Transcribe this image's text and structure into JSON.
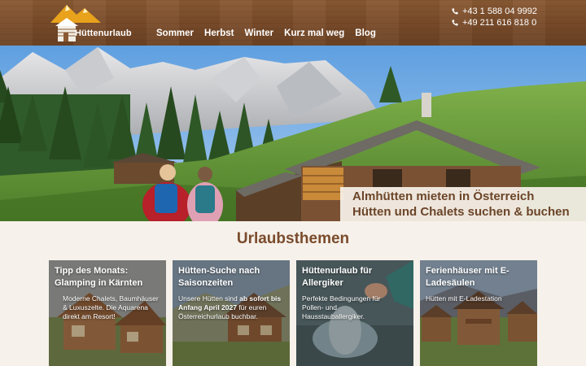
{
  "header": {
    "logo_text": "Hüttenurlaub",
    "nav": [
      {
        "label": "Sommer"
      },
      {
        "label": "Herbst"
      },
      {
        "label": "Winter"
      },
      {
        "label": "Kurz mal weg"
      },
      {
        "label": "Blog"
      }
    ],
    "phones": [
      {
        "number": "+43 1 588 04 9992",
        "icon": "phone-icon"
      },
      {
        "number": "+49 211 616 818 0",
        "icon": "phone-icon"
      }
    ]
  },
  "hero": {
    "line1": "Almhütten mieten in Österreich",
    "line2": "Hütten und Chalets suchen & buchen"
  },
  "section": {
    "title": "Urlaubsthemen"
  },
  "cards": [
    {
      "title": "Tipp des Monats: Glamping in Kärnten",
      "text_a": "Moderne Chalets, Baumhäuser & Luxuszelte. Die Aquarena direkt am Resort!"
    },
    {
      "title": "Hütten-Suche nach Saisonzeiten",
      "text_pre": "Unsere Hütten sind ",
      "text_bold": "ab sofort bis Anfang April 2027",
      "text_post": " für euren Österreichurlaub buchbar."
    },
    {
      "title": "Hüttenurlaub für Allergiker",
      "text_a": "Perfekte Bedingungen für Pollen- und Hausstauballergiker."
    },
    {
      "title": "Ferienhäuser mit E-Ladesäulen",
      "text_a": "Hütten mit E-Ladestation"
    }
  ],
  "colors": {
    "header_wood": "#7a4c2a",
    "brand_brown": "#6b4529",
    "page_bg": "#f6f1ea",
    "sky": "#7fb4e8"
  }
}
